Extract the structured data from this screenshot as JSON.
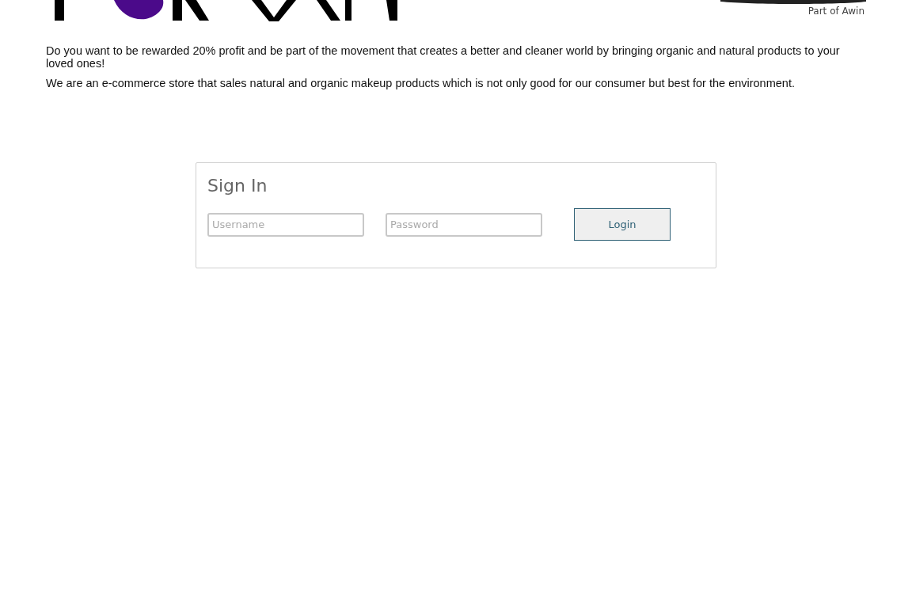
{
  "header": {
    "partner_tagline": "Part of Awin"
  },
  "intro": [
    "Do you want to be rewarded 20% profit and be part of the movement that creates a better and cleaner world by bringing organic and natural products to your loved ones!",
    "We are an e-commerce store that sales natural and organic makeup products which is not only good for our consumer but best for the environment."
  ],
  "sign_in": {
    "title": "Sign In",
    "username": {
      "placeholder": "Username"
    },
    "password": {
      "placeholder": "Password"
    },
    "button": "Login"
  }
}
